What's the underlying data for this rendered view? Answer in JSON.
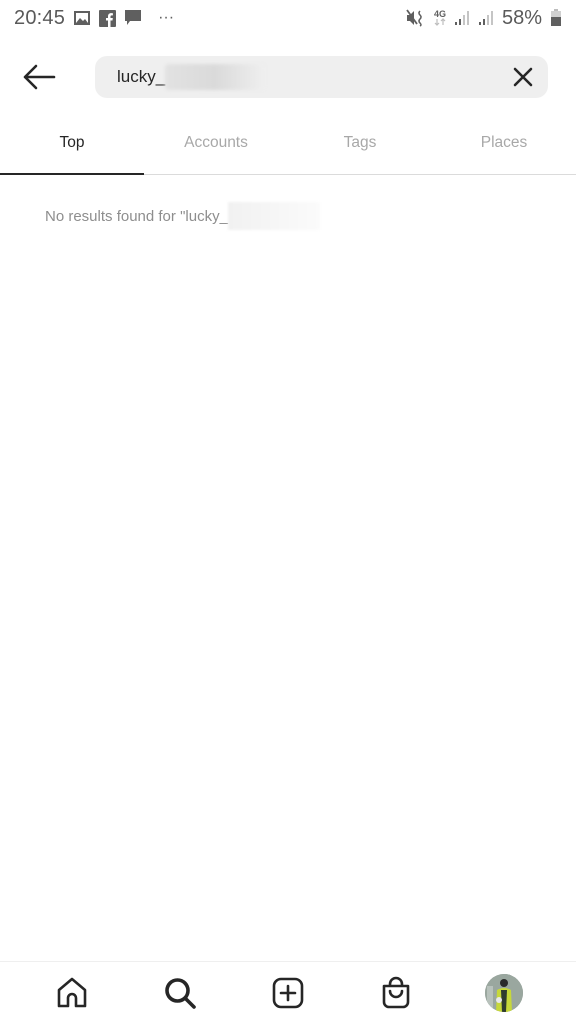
{
  "status_bar": {
    "time": "20:45",
    "notification_icons": [
      "gallery-icon",
      "facebook-icon",
      "message-icon",
      "more-dots-icon"
    ],
    "system_icons": [
      "mute-vibrate-icon",
      "4g-icon",
      "signal-icon",
      "signal-icon"
    ],
    "network_label": "4G",
    "battery_percent": "58%",
    "more_label": "···"
  },
  "search": {
    "query": "lucky_",
    "query_redacted": true,
    "back_icon": "arrow-left-icon",
    "clear_icon": "close-icon"
  },
  "tabs": [
    {
      "label": "Top",
      "active": true
    },
    {
      "label": "Accounts",
      "active": false
    },
    {
      "label": "Tags",
      "active": false
    },
    {
      "label": "Places",
      "active": false
    }
  ],
  "results": {
    "message": "No results found for \"lucky_"
  },
  "bottom_nav": {
    "items": [
      {
        "name": "home",
        "icon": "home-icon"
      },
      {
        "name": "search",
        "icon": "search-icon",
        "active": true
      },
      {
        "name": "create",
        "icon": "plus-square-icon"
      },
      {
        "name": "shop",
        "icon": "shopping-bag-icon"
      },
      {
        "name": "profile",
        "icon": "avatar"
      }
    ]
  },
  "colors": {
    "text_primary": "#262626",
    "text_secondary": "#8e8e8e",
    "tab_inactive": "#a8a8a8",
    "search_bg": "#efefef",
    "divider": "#dbdbdb"
  }
}
